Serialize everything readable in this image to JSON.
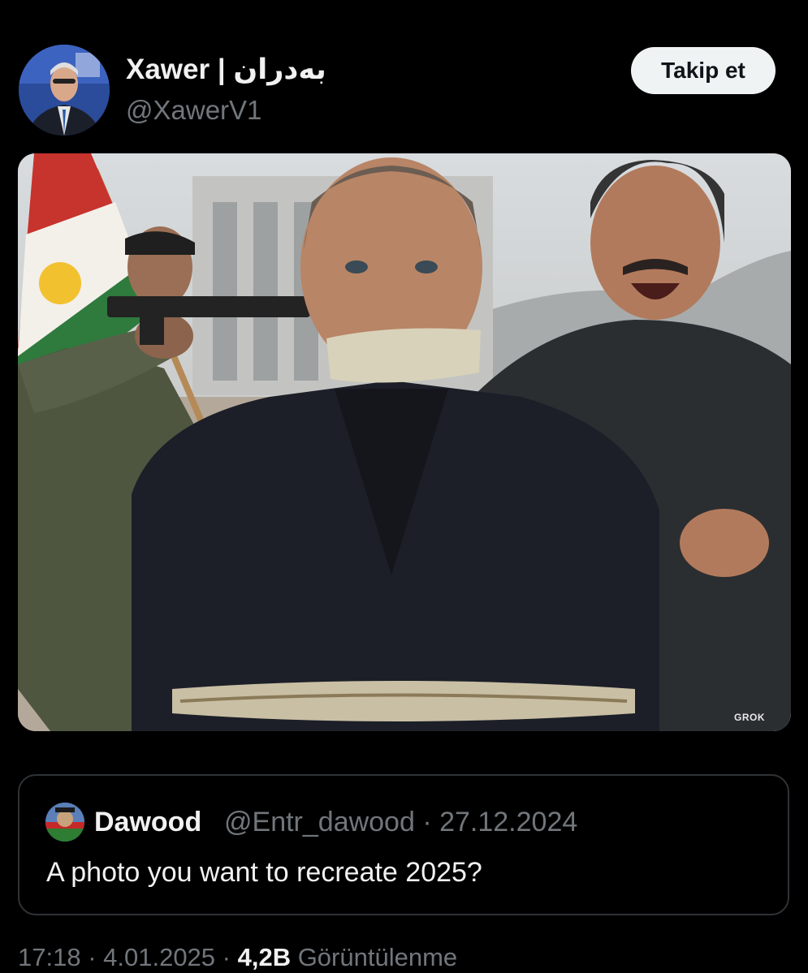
{
  "post": {
    "author": {
      "display_name": "Xawer | بەدران",
      "handle": "@XawerV1"
    },
    "follow_button_label": "Takip et",
    "media": {
      "icon": "photo",
      "watermark": "GROK"
    },
    "quoted_post": {
      "display_name": "Dawood",
      "meta": "@Entr_dawood · 27.12.2024",
      "text": "A photo you want to recreate 2025?"
    },
    "footer": {
      "time_date": "17:18 · 4.01.2025 · ",
      "views_count": "4,2B",
      "views_label": " Görüntülenme"
    }
  },
  "colors": {
    "background": "#000000",
    "text_primary": "#e7e9ea",
    "text_secondary": "#71767b",
    "follow_button_bg": "#eff3f4",
    "border": "#2f3336"
  }
}
